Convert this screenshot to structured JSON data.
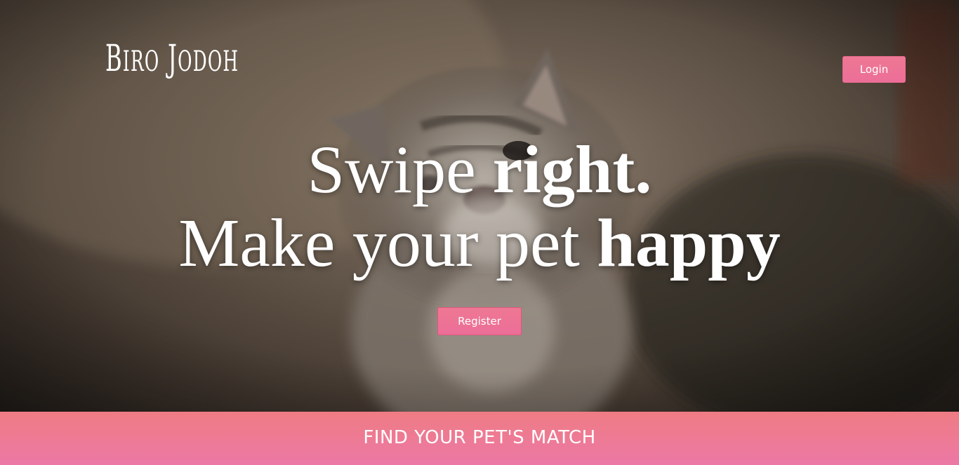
{
  "brand": {
    "first_initial": "B",
    "first_rest": "iro",
    "second_initial": "J",
    "second_rest": "odoh"
  },
  "header": {
    "login_label": "Login"
  },
  "hero": {
    "line1_regular": "Swipe ",
    "line1_bold": "right.",
    "line2_regular": "Make your pet ",
    "line2_bold": "happy",
    "register_label": "Register",
    "background_image": "kitten-photo"
  },
  "footer": {
    "cta_text": "FIND YOUR PET'S MATCH"
  },
  "colors": {
    "accent_pink": "#ee7893",
    "footer_top": "#ef7c83",
    "footer_bottom": "#ec78a6",
    "text": "#ffffff"
  }
}
